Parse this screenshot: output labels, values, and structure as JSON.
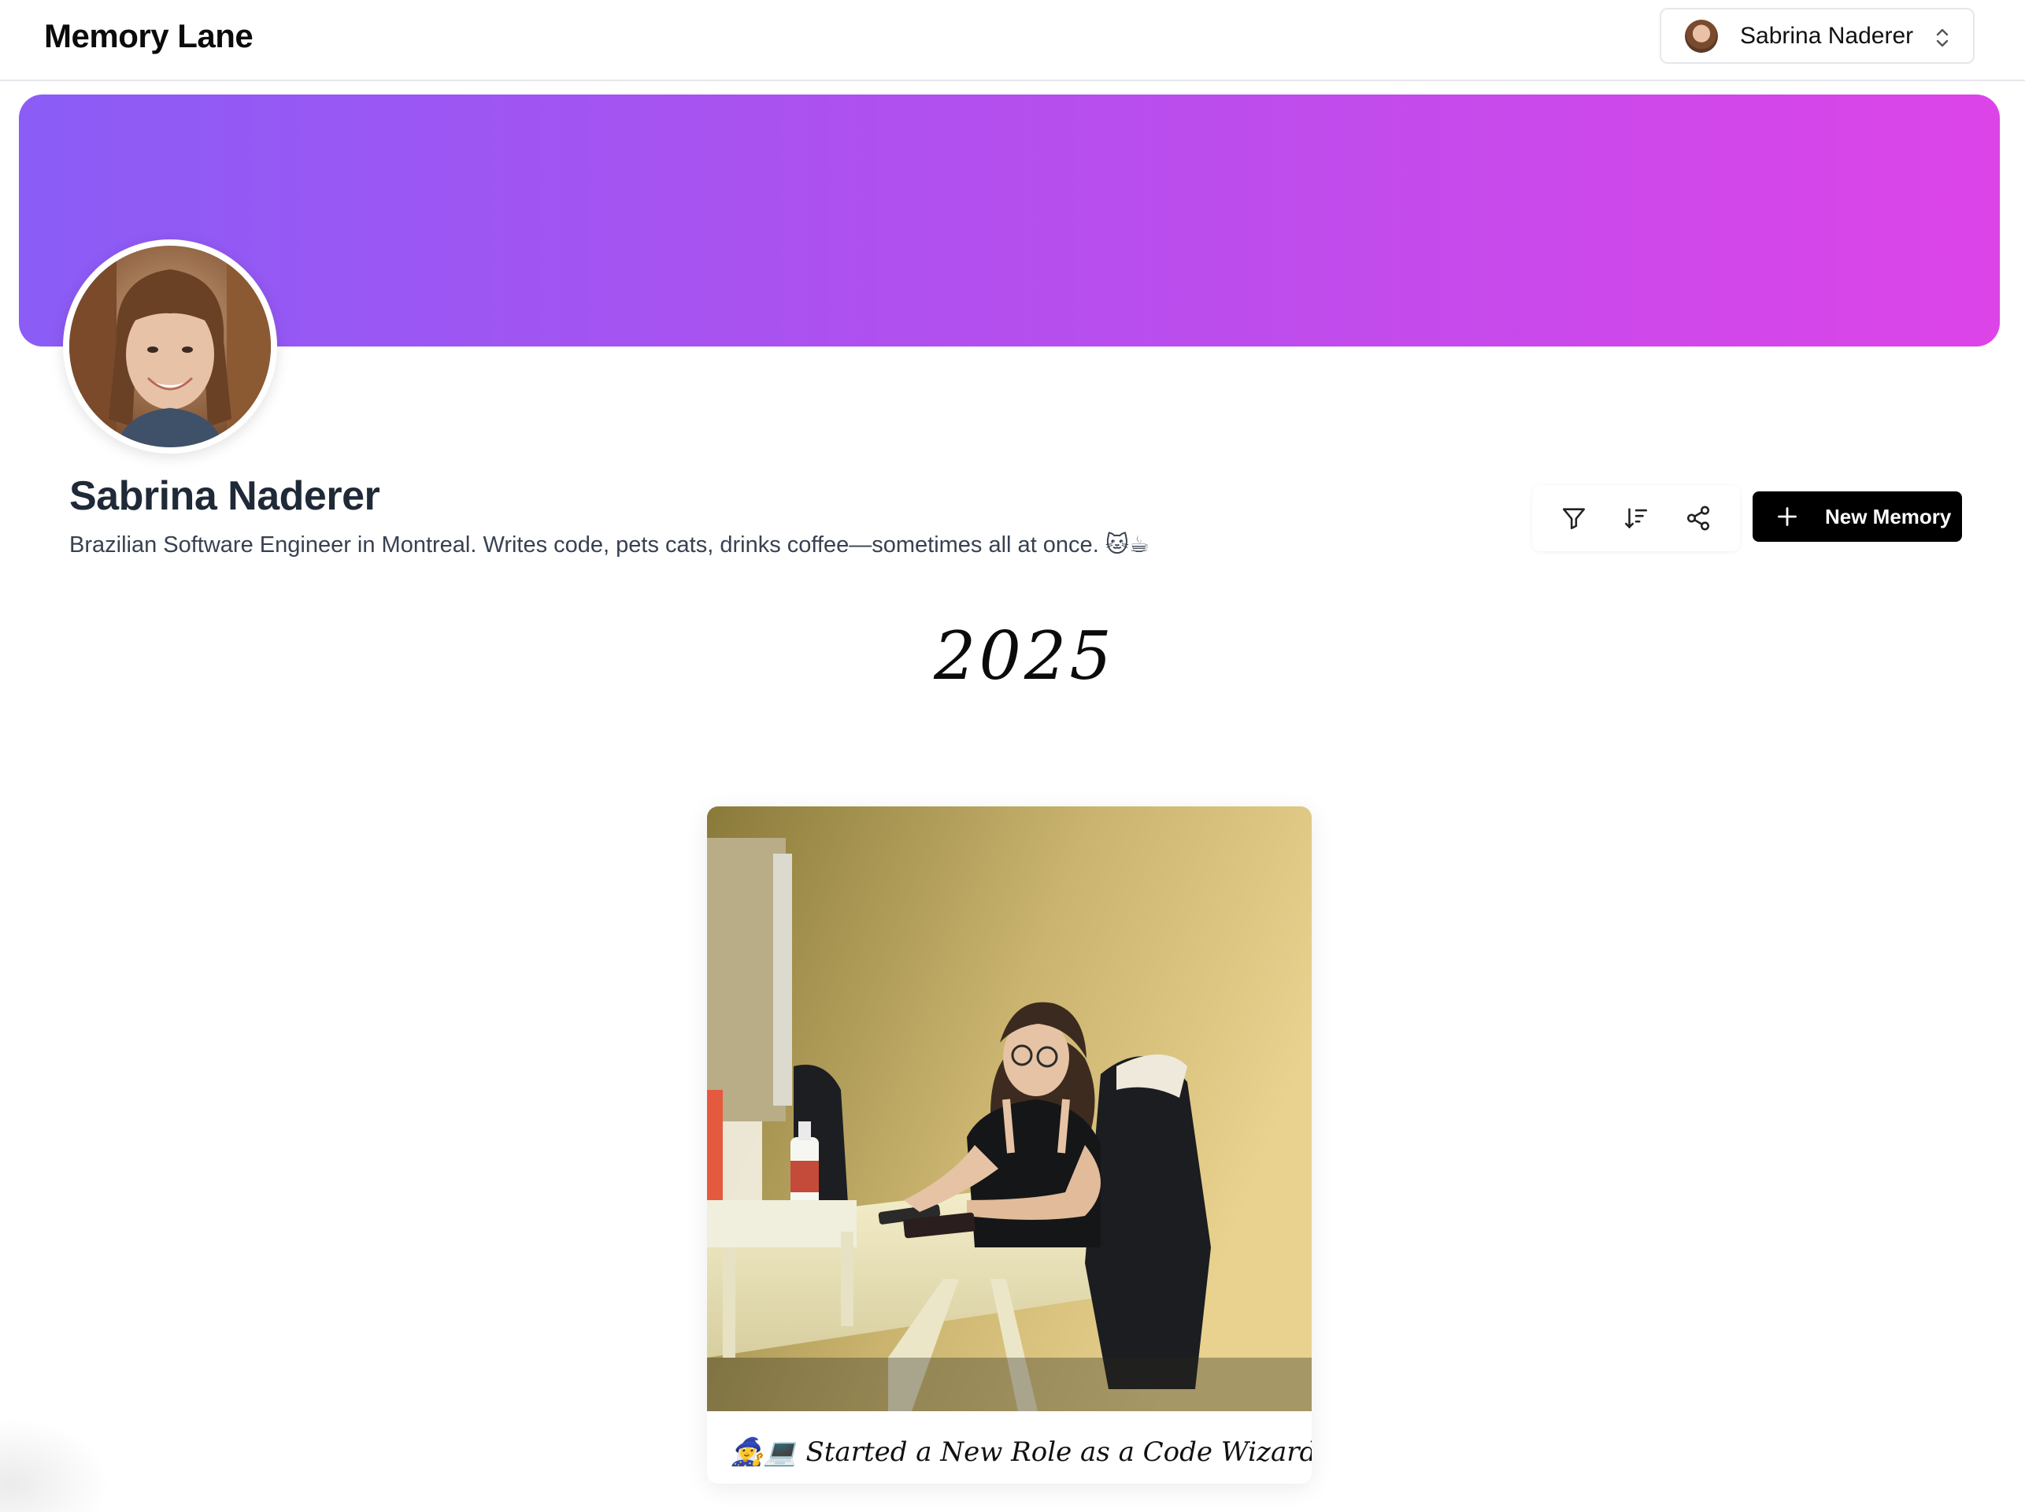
{
  "header": {
    "app_title": "Memory Lane",
    "user_switcher": {
      "name": "Sabrina Naderer"
    }
  },
  "profile": {
    "name": "Sabrina Naderer",
    "bio": "Brazilian Software Engineer in Montreal. Writes code, pets cats, drinks coffee—sometimes all at once. 🐱☕",
    "banner_colors": [
      "#8b5cf6",
      "#dc44e8"
    ]
  },
  "toolbar": {
    "icons": [
      "filter-icon",
      "sort-icon",
      "share-icon"
    ],
    "new_memory_label": "New Memory"
  },
  "timeline": {
    "year": "2025",
    "memories": [
      {
        "caption": "🧙‍♀️💻 Started a New Role as a Code Wizard at"
      }
    ]
  }
}
